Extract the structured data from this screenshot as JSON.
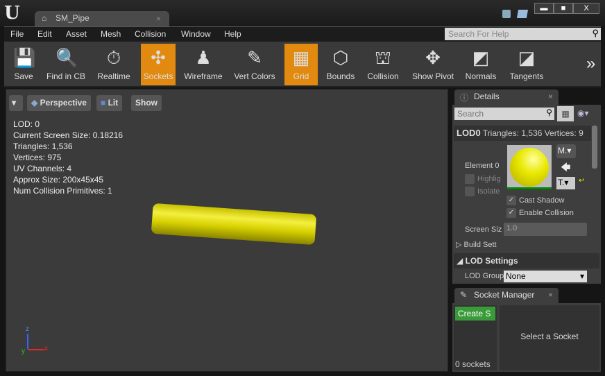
{
  "window": {
    "tab_title": "SM_Pipe",
    "tab_close": "×",
    "minimize": "▬",
    "maximize": "■",
    "close": "X"
  },
  "menu": [
    "File",
    "Edit",
    "Asset",
    "Mesh",
    "Collision",
    "Window",
    "Help"
  ],
  "help_search": {
    "placeholder": "Search For Help"
  },
  "toolbar": [
    {
      "label": "Save",
      "icon": "💾",
      "active": false
    },
    {
      "label": "Find in CB",
      "icon": "🔍",
      "active": false
    },
    {
      "label": "Realtime",
      "icon": "⏱",
      "active": false
    },
    {
      "label": "Sockets",
      "icon": "✣",
      "active": true
    },
    {
      "label": "Wireframe",
      "icon": "♟",
      "active": false
    },
    {
      "label": "Vert Colors",
      "icon": "✎",
      "active": false
    },
    {
      "label": "Grid",
      "icon": "▦",
      "active": true
    },
    {
      "label": "Bounds",
      "icon": "⬡",
      "active": false
    },
    {
      "label": "Collision",
      "icon": "⛫",
      "active": false
    },
    {
      "label": "Show Pivot",
      "icon": "✥",
      "active": false
    },
    {
      "label": "Normals",
      "icon": "◩",
      "active": false
    },
    {
      "label": "Tangents",
      "icon": "◪",
      "active": false
    }
  ],
  "toolbar_more": "»",
  "viewport": {
    "buttons": [
      "Perspective",
      "Lit",
      "Show"
    ],
    "stats": [
      "LOD:  0",
      "Current Screen Size:  0.18216",
      "Triangles:  1,536",
      "Vertices:  975",
      "UV Channels:  4",
      "Approx Size: 200x45x45",
      "Num Collision Primitives:  1"
    ],
    "axis": {
      "z": "z",
      "x": "x",
      "y": "y"
    }
  },
  "details": {
    "tab": "Details",
    "close": "×",
    "search_placeholder": "Search",
    "lod0_title": "LOD0",
    "lod0_info": "Triangles: 1,536    Vertices: 9",
    "element": "Element 0",
    "highlight": "Highlig",
    "isolate": "Isolate",
    "mat_btn": "M.",
    "tex_btn": "T.",
    "cast_shadow": "Cast Shadow",
    "enable_collision": "Enable Collision",
    "screen_size_label": "Screen Siz",
    "screen_size_value": "1.0",
    "build_settings": "Build Sett",
    "lod_settings": "LOD Settings",
    "lod_group_label": "LOD Group",
    "lod_group_value": "None"
  },
  "socket_manager": {
    "tab": "Socket Manager",
    "close": "×",
    "create_button": "Create S",
    "count": "0 sockets",
    "empty_message": "Select a Socket"
  }
}
